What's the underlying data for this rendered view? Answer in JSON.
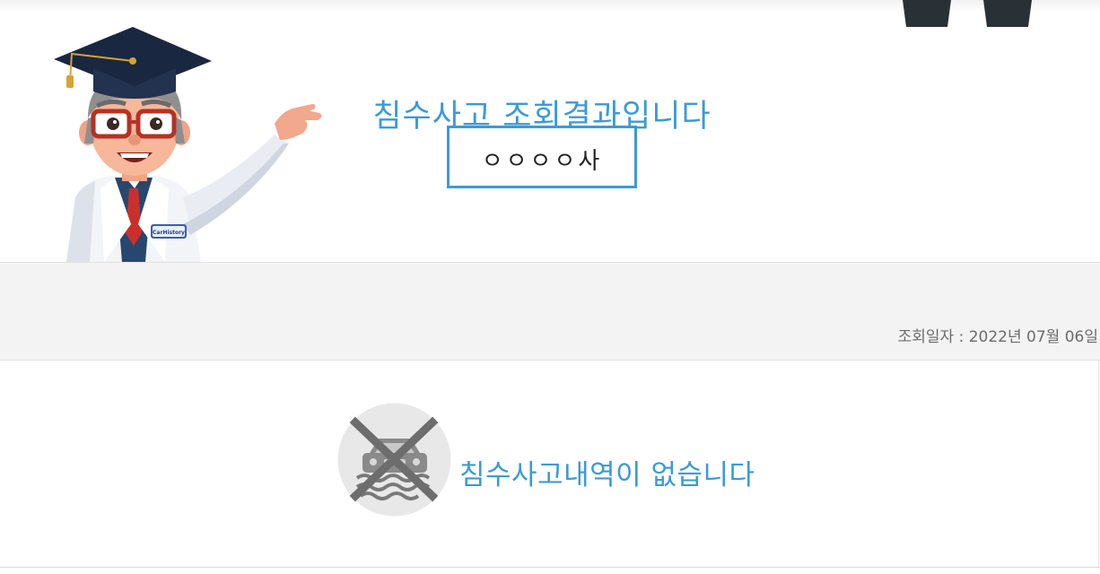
{
  "header": {
    "title": "침수사고 조회결과입니다",
    "plate_number": "ㅇㅇㅇㅇ사"
  },
  "mascot": {
    "badge_text": "CarHistory"
  },
  "query": {
    "date_text": "조회일자 : 2022년 07월 06일"
  },
  "result": {
    "message": "침수사고내역이 없습니다",
    "icon": "no-flood-icon"
  },
  "colors": {
    "accent": "#3b9ad8",
    "band": "#f3f3f3",
    "muted_text": "#6b6b6b"
  }
}
